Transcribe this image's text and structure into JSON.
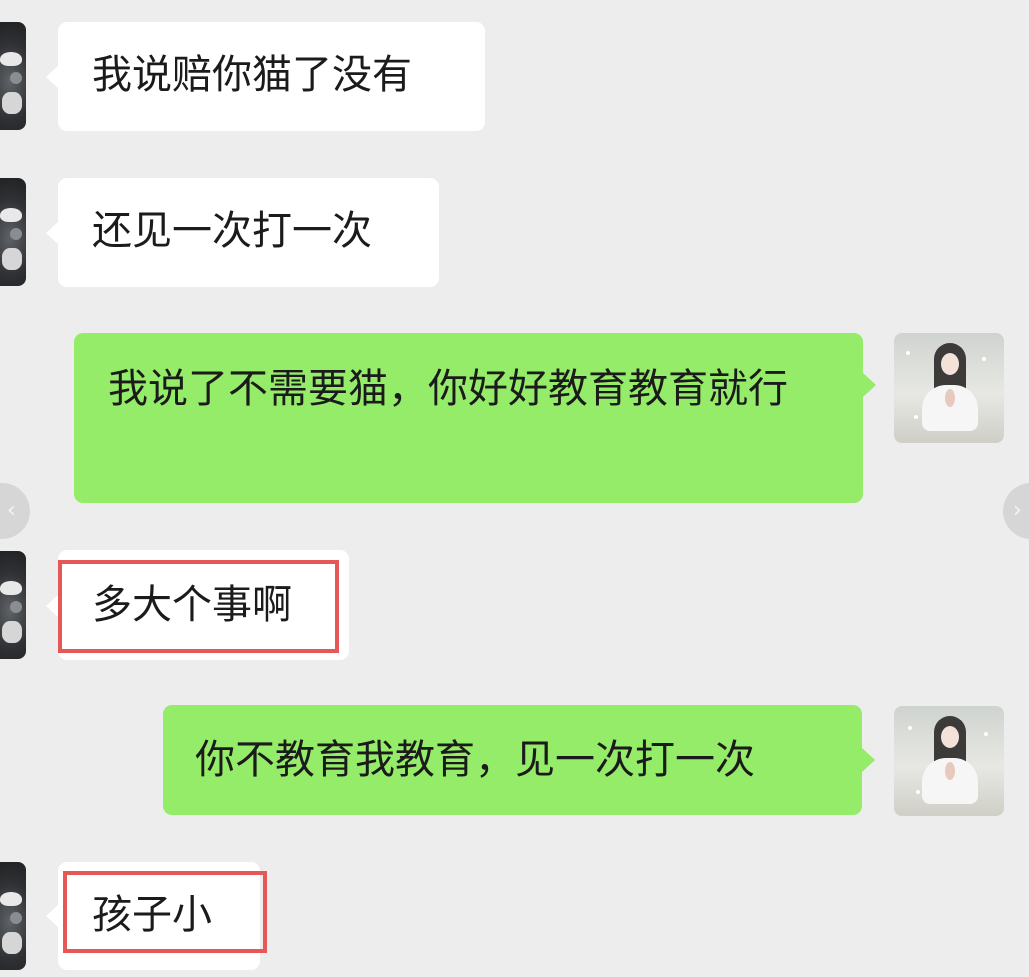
{
  "chat": {
    "messages": [
      {
        "sender": "contact",
        "text": "我说赔你猫了没有"
      },
      {
        "sender": "contact",
        "text": "还见一次打一次"
      },
      {
        "sender": "me",
        "text": "我说了不需要猫，你好好教育教育就行"
      },
      {
        "sender": "contact",
        "text": "多大个事啊",
        "highlighted": true
      },
      {
        "sender": "me",
        "text": "你不教育我教育，见一次打一次"
      },
      {
        "sender": "contact",
        "text": "孩子小",
        "highlighted": true
      }
    ]
  },
  "navigation": {
    "prev_icon": "‹",
    "next_icon": "›"
  },
  "theme": {
    "background": "#ededed",
    "incoming_bubble": "#ffffff",
    "outgoing_bubble": "#95ec69",
    "highlight_border": "#e65757"
  },
  "icons": {
    "contact_avatar": "contact-avatar-icon",
    "my_avatar": "my-avatar-icon",
    "prev": "chevron-left-icon",
    "next": "chevron-right-icon"
  }
}
